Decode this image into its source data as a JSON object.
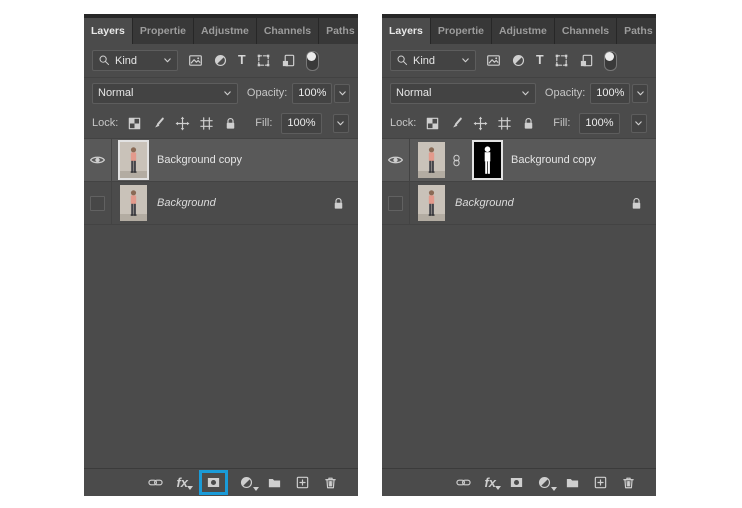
{
  "colors": {
    "highlight_blue": "#1a9bd8",
    "panel_background": "#4b4b4b",
    "tabbar_background": "#272727",
    "selected_row_background": "#595959",
    "mask_thumbnail_background": "#000000",
    "mask_silhouette": "#ffffff"
  },
  "panel": {
    "tabs": [
      {
        "label": "Layers",
        "active": true
      },
      {
        "label": "Propertie",
        "active": false
      },
      {
        "label": "Adjustme",
        "active": false
      },
      {
        "label": "Channels",
        "active": false
      },
      {
        "label": "Paths",
        "active": false
      }
    ],
    "menu_icon": "panel-menu-icon",
    "filter_row": {
      "search_icon": "search-icon",
      "kind_value": "Kind",
      "chevron_icon": "chevron-down-icon",
      "type_glyph": "T",
      "filter_icons": [
        "pixel-layers-filter-icon",
        "adjustment-layers-filter-icon",
        "type-layers-filter-icon",
        "shape-layers-filter-icon",
        "smart-objects-filter-icon",
        "layer-filtering-toggle-icon"
      ]
    },
    "blend_row": {
      "blend_mode": "Normal",
      "opacity_label": "Opacity:",
      "opacity_value": "100%"
    },
    "lock_row": {
      "lock_label": "Lock:",
      "lock_icons": [
        "lock-transparent-pixels-icon",
        "lock-image-pixels-icon",
        "lock-position-icon",
        "lock-artboard-icon",
        "lock-all-icon"
      ],
      "fill_label": "Fill:",
      "fill_value": "100%"
    },
    "layers": [
      {
        "name": "Background copy",
        "selected": true,
        "visible": true
      },
      {
        "name": "Background",
        "selected": false,
        "visible": false,
        "locked": true,
        "italic": true
      }
    ],
    "toolbar": {
      "fx_label": "fx",
      "icons": [
        "link-layers-icon",
        "layer-style-icon",
        "add-layer-mask-icon",
        "new-adjustment-layer-icon",
        "new-group-icon",
        "new-layer-icon",
        "delete-layer-icon"
      ]
    }
  },
  "state": {
    "left_panel": {
      "add_layer_mask_button_highlighted": true,
      "background_copy_has_mask": false,
      "image_thumbnail_selected": true
    },
    "right_panel": {
      "add_layer_mask_button_highlighted": false,
      "background_copy_has_mask": true,
      "mask_thumbnail_selected": true
    }
  }
}
